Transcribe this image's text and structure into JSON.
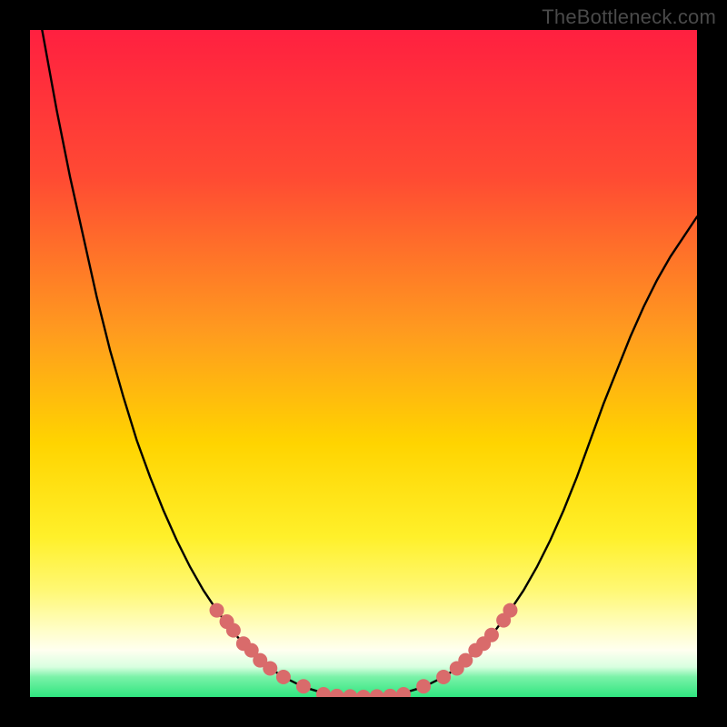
{
  "watermark": "TheBottleneck.com",
  "colors": {
    "frame": "#000000",
    "curve": "#000000",
    "marker_fill": "#d96b6b",
    "marker_stroke": "#c95b5b",
    "gradient_top": "#ff2040",
    "gradient_mid1": "#ff7a2a",
    "gradient_mid2": "#ffd400",
    "gradient_yellow_pale": "#fff27a",
    "gradient_cream": "#fffde0",
    "gradient_green": "#2fe57f"
  },
  "chart_data": {
    "type": "line",
    "title": "",
    "xlabel": "",
    "ylabel": "",
    "xlim": [
      0,
      100
    ],
    "ylim": [
      0,
      100
    ],
    "x": [
      0,
      2,
      4,
      6,
      8,
      10,
      12,
      14,
      16,
      18,
      20,
      22,
      24,
      26,
      28,
      30,
      32,
      34,
      36,
      38,
      40,
      42,
      44,
      46,
      48,
      50,
      52,
      54,
      56,
      58,
      60,
      62,
      64,
      66,
      68,
      70,
      72,
      74,
      76,
      78,
      80,
      82,
      84,
      86,
      88,
      90,
      92,
      94,
      96,
      98,
      100
    ],
    "y": [
      110,
      99,
      88,
      78,
      69,
      60,
      52,
      45,
      38.5,
      33,
      28,
      23.5,
      19.5,
      16,
      13,
      10.3,
      8,
      6,
      4.3,
      3,
      2,
      1.2,
      0.6,
      0.25,
      0.08,
      0,
      0.08,
      0.25,
      0.6,
      1.2,
      2,
      3,
      4.3,
      6,
      8,
      10.3,
      13,
      16,
      19.5,
      23.5,
      28,
      33,
      38.5,
      44,
      49,
      54,
      58.5,
      62.5,
      66,
      69,
      72
    ],
    "markers": [
      {
        "x": 28,
        "y": 13
      },
      {
        "x": 29.5,
        "y": 11.3
      },
      {
        "x": 30.5,
        "y": 10
      },
      {
        "x": 32,
        "y": 8
      },
      {
        "x": 33.2,
        "y": 7
      },
      {
        "x": 34.5,
        "y": 5.5
      },
      {
        "x": 36,
        "y": 4.3
      },
      {
        "x": 38,
        "y": 3
      },
      {
        "x": 41,
        "y": 1.6
      },
      {
        "x": 44,
        "y": 0.4
      },
      {
        "x": 46,
        "y": 0.15
      },
      {
        "x": 48,
        "y": 0.08
      },
      {
        "x": 50,
        "y": 0
      },
      {
        "x": 52,
        "y": 0.08
      },
      {
        "x": 54,
        "y": 0.15
      },
      {
        "x": 56,
        "y": 0.4
      },
      {
        "x": 59,
        "y": 1.6
      },
      {
        "x": 62,
        "y": 3
      },
      {
        "x": 64,
        "y": 4.3
      },
      {
        "x": 65.3,
        "y": 5.5
      },
      {
        "x": 66.8,
        "y": 7
      },
      {
        "x": 68,
        "y": 8
      },
      {
        "x": 69.2,
        "y": 9.3
      },
      {
        "x": 71,
        "y": 11.5
      },
      {
        "x": 72,
        "y": 13
      }
    ],
    "gradient_stops": [
      {
        "pct": 0,
        "color": "#ff2040"
      },
      {
        "pct": 22,
        "color": "#ff4a33"
      },
      {
        "pct": 45,
        "color": "#ff9a1f"
      },
      {
        "pct": 62,
        "color": "#ffd400"
      },
      {
        "pct": 76,
        "color": "#fff02a"
      },
      {
        "pct": 84,
        "color": "#fff874"
      },
      {
        "pct": 90,
        "color": "#fffec8"
      },
      {
        "pct": 93,
        "color": "#fffff0"
      },
      {
        "pct": 95.5,
        "color": "#d8ffe0"
      },
      {
        "pct": 97,
        "color": "#7af2a8"
      },
      {
        "pct": 100,
        "color": "#2fe57f"
      }
    ]
  }
}
